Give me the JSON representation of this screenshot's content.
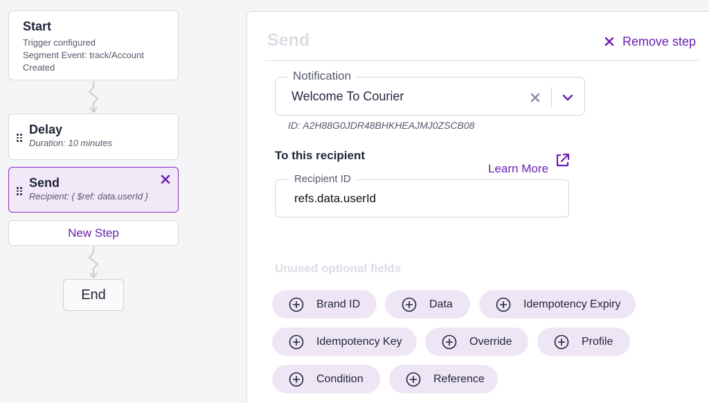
{
  "workflow": {
    "start": {
      "title": "Start",
      "lines": [
        "Trigger configured",
        "Segment Event: track/Account",
        "Created"
      ]
    },
    "delay": {
      "title": "Delay",
      "subtitle": "Duration: 10 minutes"
    },
    "send": {
      "title": "Send",
      "subtitle": "Recipient: { $ref: data.userId }"
    },
    "new_step_label": "New Step",
    "end_label": "End"
  },
  "panel": {
    "title": "Send",
    "remove_step_label": "Remove step",
    "notification": {
      "label": "Notification",
      "value": "Welcome To Courier",
      "id_text": "ID: A2H88G0JDR48BHKHEAJMJ0ZSCB08"
    },
    "recipient": {
      "heading": "To this recipient",
      "learn_more": "Learn More",
      "field_label": "Recipient ID",
      "field_value": "refs.data.userId"
    },
    "unused_heading": "Unused optional fields",
    "optional_fields": [
      "Brand ID",
      "Data",
      "Idempotency Expiry",
      "Idempotency Key",
      "Override",
      "Profile",
      "Condition",
      "Reference"
    ]
  },
  "colors": {
    "accent": "#6b1fb0",
    "chip_bg": "#efe6f5",
    "selected_card_bg": "#f1e8f8"
  }
}
